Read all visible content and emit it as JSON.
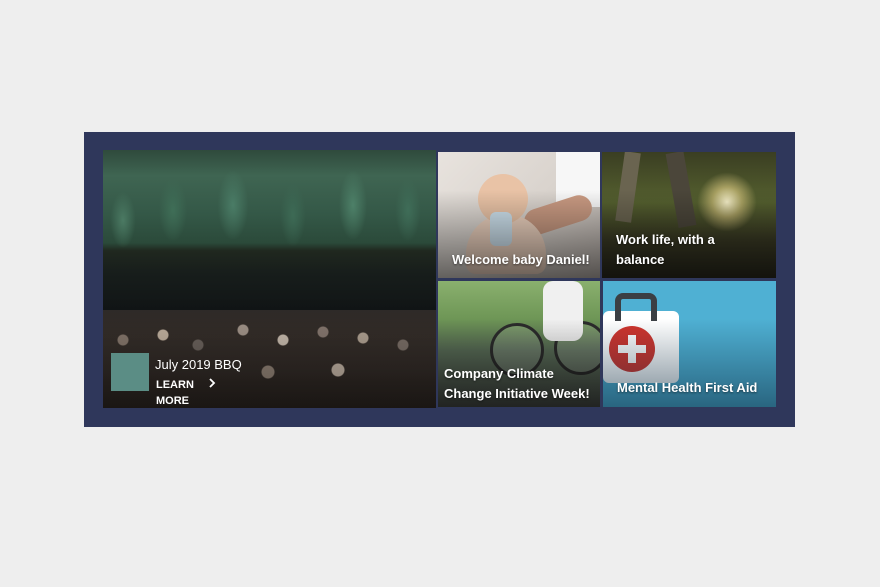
{
  "hero": {
    "title": "July 2019 BBQ",
    "link_label": "LEARN MORE",
    "link_icon": "chevron-right-icon",
    "swatch_color": "#5b8d85"
  },
  "tiles": [
    {
      "title": "Welcome baby Daniel!"
    },
    {
      "title": "Work life, with a balance"
    },
    {
      "title": "Company Climate Change Initiative Week!"
    },
    {
      "title": "Mental Health First Aid"
    }
  ],
  "colors": {
    "frame": "#2f375b",
    "page_background": "#eeeeee",
    "mental_health_tile": "#4fb0d3"
  }
}
